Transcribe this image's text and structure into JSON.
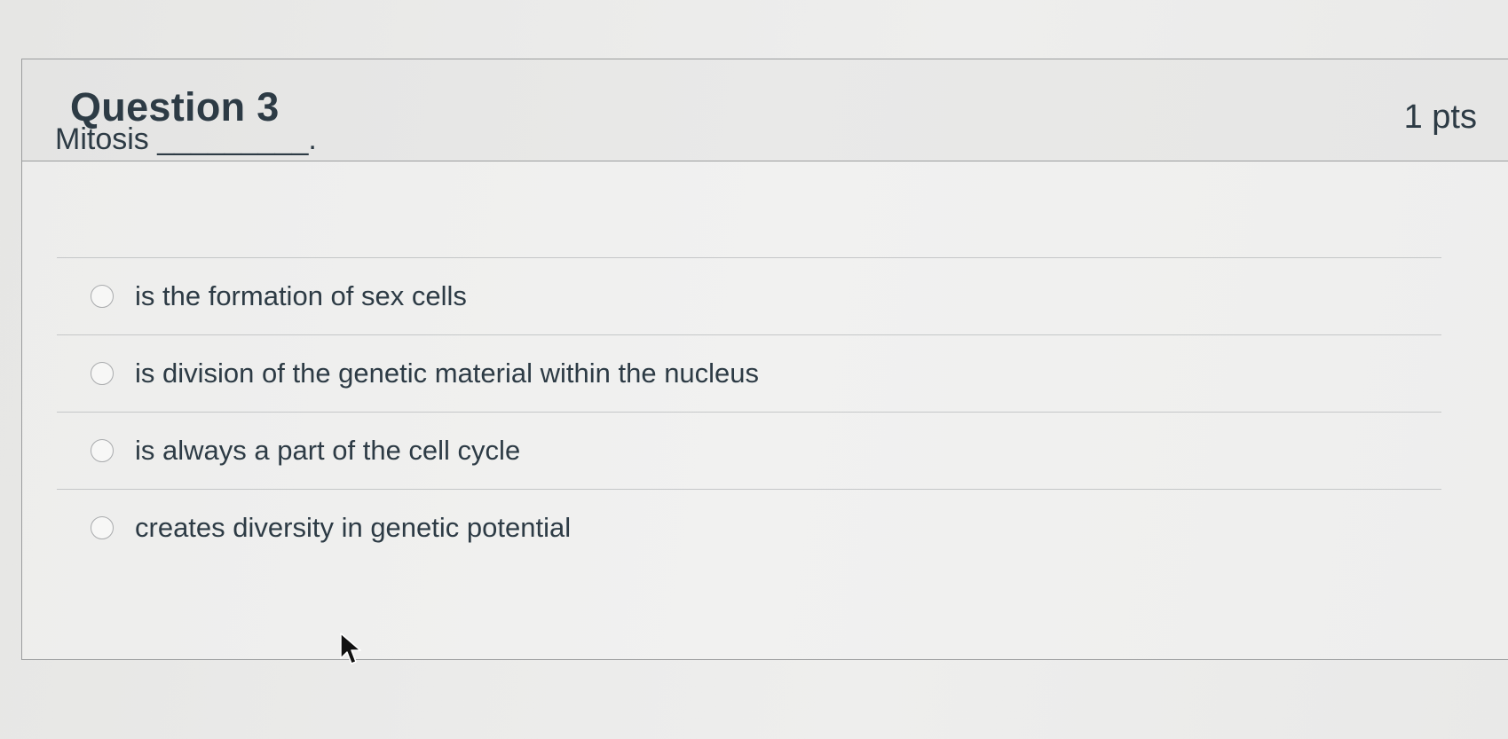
{
  "question": {
    "title": "Question 3",
    "points": "1 pts",
    "text": "Mitosis _________.",
    "answers": [
      {
        "label": "is the formation of sex cells",
        "selected": false
      },
      {
        "label": "is division of the genetic material within the nucleus",
        "selected": false
      },
      {
        "label": "is always a part of the cell cycle",
        "selected": false
      },
      {
        "label": "creates diversity in genetic potential",
        "selected": false
      }
    ]
  },
  "icons": {
    "cursor": "mouse-pointer-icon",
    "radio": "radio-button-icon"
  },
  "colors": {
    "text": "#2d3b45",
    "border": "#9b9d9e",
    "divider": "#c5c7c8"
  }
}
